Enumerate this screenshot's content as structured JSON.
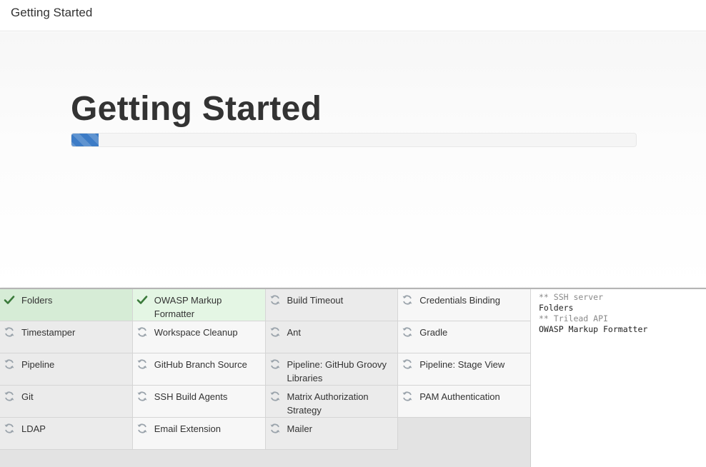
{
  "header": {
    "title": "Getting Started"
  },
  "hero": {
    "heading": "Getting Started",
    "progress": 0.048,
    "progress_color": "#3d7cc6"
  },
  "plugins": [
    {
      "name": "Folders",
      "status": "installed",
      "icon": "check-icon"
    },
    {
      "name": "OWASP Markup Formatter",
      "status": "installed",
      "icon": "check-icon"
    },
    {
      "name": "Build Timeout",
      "status": "pending",
      "icon": "refresh-icon"
    },
    {
      "name": "Credentials Binding",
      "status": "pending",
      "icon": "refresh-icon"
    },
    {
      "name": "Timestamper",
      "status": "pending",
      "icon": "refresh-icon"
    },
    {
      "name": "Workspace Cleanup",
      "status": "pending",
      "icon": "refresh-icon"
    },
    {
      "name": "Ant",
      "status": "pending",
      "icon": "refresh-icon"
    },
    {
      "name": "Gradle",
      "status": "pending",
      "icon": "refresh-icon"
    },
    {
      "name": "Pipeline",
      "status": "pending",
      "icon": "refresh-icon"
    },
    {
      "name": "GitHub Branch Source",
      "status": "pending",
      "icon": "refresh-icon"
    },
    {
      "name": "Pipeline: GitHub Groovy Libraries",
      "status": "pending",
      "icon": "refresh-icon"
    },
    {
      "name": "Pipeline: Stage View",
      "status": "pending",
      "icon": "refresh-icon"
    },
    {
      "name": "Git",
      "status": "pending",
      "icon": "refresh-icon"
    },
    {
      "name": "SSH Build Agents",
      "status": "pending",
      "icon": "refresh-icon"
    },
    {
      "name": "Matrix Authorization Strategy",
      "status": "pending",
      "icon": "refresh-icon"
    },
    {
      "name": "PAM Authentication",
      "status": "pending",
      "icon": "refresh-icon"
    },
    {
      "name": "LDAP",
      "status": "pending",
      "icon": "refresh-icon"
    },
    {
      "name": "Email Extension",
      "status": "pending",
      "icon": "refresh-icon"
    },
    {
      "name": "Mailer",
      "status": "pending",
      "icon": "refresh-icon"
    }
  ],
  "log": [
    {
      "text": "** SSH server",
      "dim": true
    },
    {
      "text": "Folders",
      "dim": false
    },
    {
      "text": "** Trilead API",
      "dim": true
    },
    {
      "text": "OWASP Markup Formatter",
      "dim": false
    }
  ],
  "colors": {
    "installed_bg": "#d6ecd6",
    "check": "#3a7a3a",
    "pending_icon": "#9aa3ab"
  }
}
